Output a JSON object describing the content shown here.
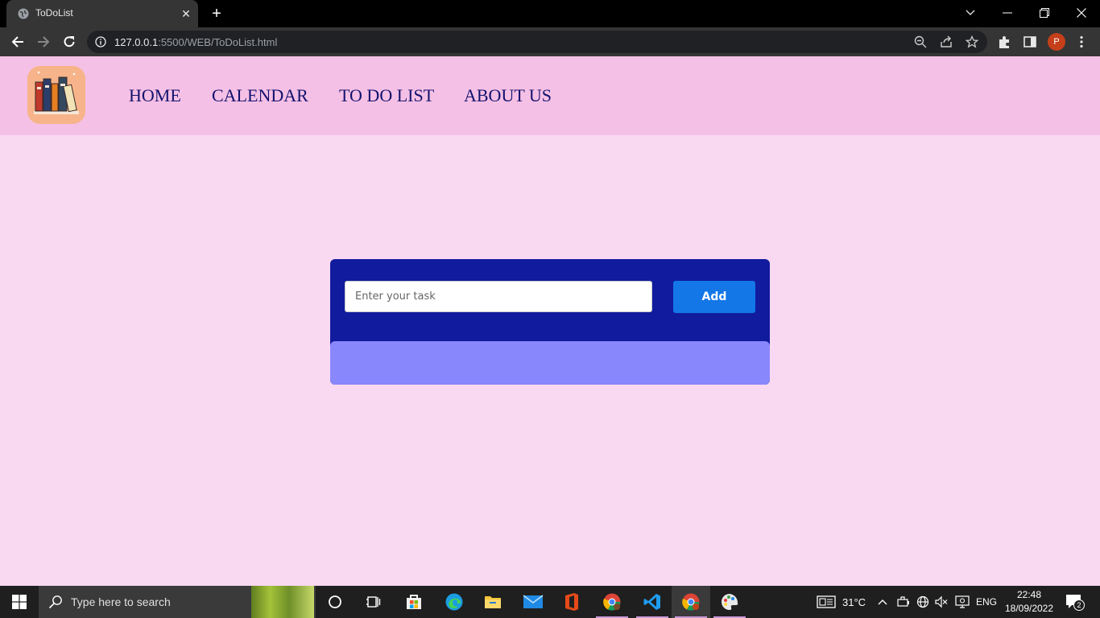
{
  "browser": {
    "tab_title": "ToDoList",
    "url_host": "127.0.0.1",
    "url_rest": ":5500/WEB/ToDoList.html",
    "profile_initial": "P"
  },
  "site": {
    "nav": [
      "HOME",
      "CALENDAR",
      "TO DO LIST",
      "ABOUT US"
    ]
  },
  "todo": {
    "input_placeholder": "Enter your task",
    "input_value": "",
    "add_label": "Add"
  },
  "taskbar": {
    "search_placeholder": "Type here to search",
    "temperature": "31°C",
    "language": "ENG",
    "time": "22:48",
    "date": "18/09/2022",
    "notification_count": "2"
  },
  "colors": {
    "page_bg": "#f9d8f2",
    "navbar_bg": "#f5c0e5",
    "nav_text": "#12126e",
    "card_bg": "#111b9e",
    "list_bg": "#8887fc",
    "add_button": "#1477e8"
  }
}
